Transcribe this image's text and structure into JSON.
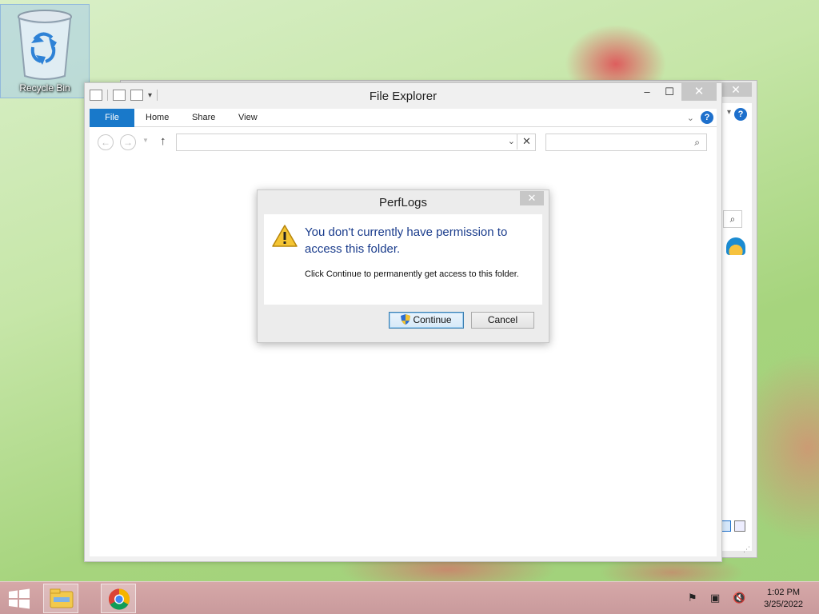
{
  "desktop": {
    "icon_label": "Recycle Bin"
  },
  "explorer": {
    "title": "File Explorer",
    "ribbon_tabs": [
      "File",
      "Home",
      "Share",
      "View"
    ],
    "controls": {
      "minimize": "–",
      "maximize": "☐",
      "close": "✕"
    },
    "address_value": "",
    "search_placeholder": ""
  },
  "dialog": {
    "title": "PerfLogs",
    "main_message": "You don't currently have permission to access this folder.",
    "sub_message": "Click Continue to permanently get access to this folder.",
    "continue_label": "Continue",
    "cancel_label": "Cancel",
    "close": "✕"
  },
  "taskbar": {
    "time": "1:02 PM",
    "date": "3/25/2022"
  },
  "colors": {
    "accent": "#1979ca",
    "dialog_text": "#1a3c8c",
    "taskbar": "#c99a9c"
  }
}
